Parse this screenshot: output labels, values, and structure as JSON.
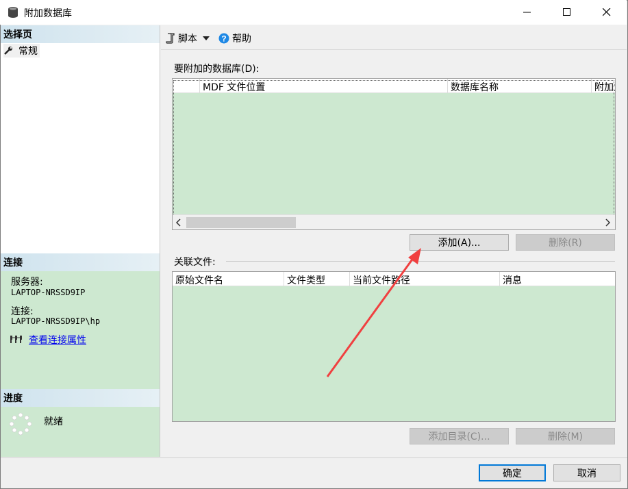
{
  "window": {
    "title": "附加数据库",
    "controls": {
      "minimize": "minimize-icon",
      "maximize": "maximize-icon",
      "close": "close-icon"
    }
  },
  "left": {
    "select_page_header": "选择页",
    "pages": [
      {
        "label": "常规",
        "icon": "wrench-icon"
      }
    ],
    "connection_header": "连接",
    "server_label": "服务器:",
    "server_value": "LAPTOP-NRSSD9IP",
    "connection_label": "连接:",
    "connection_value": "LAPTOP-NRSSD9IP\\hp",
    "view_props_link": "查看连接属性",
    "progress_header": "进度",
    "progress_status": "就绪"
  },
  "toolbar": {
    "script_label": "脚本",
    "help_label": "帮助"
  },
  "attach": {
    "label": "要附加的数据库(D):",
    "columns": [
      "",
      "MDF 文件位置",
      "数据库名称",
      "附加为"
    ],
    "add_button": "添加(A)...",
    "remove_button": "删除(R)"
  },
  "related": {
    "label": "关联文件:",
    "columns": [
      "原始文件名",
      "文件类型",
      "当前文件路径",
      "消息"
    ],
    "add_catalog_button": "添加目录(C)...",
    "remove_button": "删除(M)"
  },
  "footer": {
    "ok_button": "确定",
    "cancel_button": "取消"
  },
  "colors": {
    "grid_bg": "#cde8d0",
    "header_gradient": "#cfe3ee",
    "accent": "#0078d7",
    "annotation_arrow": "#f04040"
  }
}
